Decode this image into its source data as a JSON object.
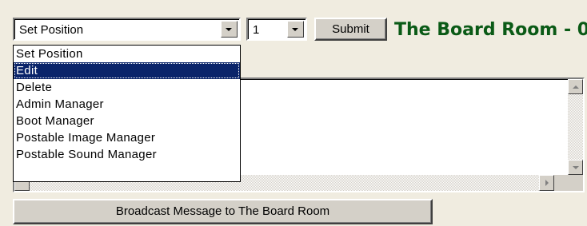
{
  "action_select": {
    "value": "Set Position"
  },
  "number_select": {
    "value": "1"
  },
  "submit_label": "Submit",
  "room_title": "The Board Room - 0",
  "dropdown": {
    "items": [
      {
        "label": "Set Position"
      },
      {
        "label": "Edit"
      },
      {
        "label": "Delete"
      },
      {
        "label": "Admin Manager"
      },
      {
        "label": "Boot Manager"
      },
      {
        "label": "Postable Image Manager"
      },
      {
        "label": "Postable Sound Manager"
      }
    ],
    "selected": "Edit"
  },
  "broadcast_label": "Broadcast Message to The Board Room",
  "colors": {
    "title": "#0a5a16",
    "highlight": "#0a246a",
    "face": "#d4d0c8"
  }
}
